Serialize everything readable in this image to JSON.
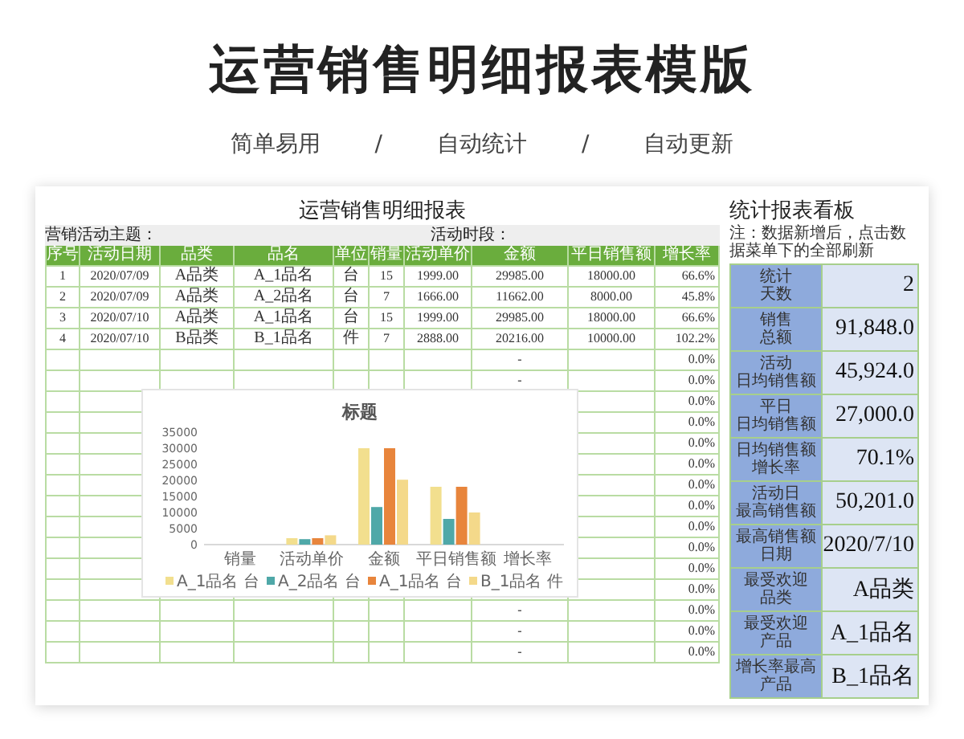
{
  "page": {
    "title": "运营销售明细报表模版",
    "features": [
      "简单易用",
      "自动统计",
      "自动更新"
    ],
    "separator": "/"
  },
  "sheet": {
    "title": "运营销售明细报表",
    "theme_label": "营销活动主题：",
    "period_label": "活动时段：",
    "columns": [
      "序号",
      "活动日期",
      "品类",
      "品名",
      "单位",
      "销量",
      "活动单价",
      "金额",
      "平日销售额",
      "增长率"
    ],
    "rows": [
      {
        "cells": [
          "1",
          "2020/07/09",
          "A品类",
          "A_1品名",
          "台",
          "15",
          "1999.00",
          "29985.00",
          "18000.00",
          "66.6%"
        ]
      },
      {
        "cells": [
          "2",
          "2020/07/09",
          "A品类",
          "A_2品名",
          "台",
          "7",
          "1666.00",
          "11662.00",
          "8000.00",
          "45.8%"
        ]
      },
      {
        "cells": [
          "3",
          "2020/07/10",
          "A品类",
          "A_1品名",
          "台",
          "15",
          "1999.00",
          "29985.00",
          "18000.00",
          "66.6%"
        ]
      },
      {
        "cells": [
          "4",
          "2020/07/10",
          "B品类",
          "B_1品名",
          "件",
          "7",
          "2888.00",
          "20216.00",
          "10000.00",
          "102.2%"
        ]
      },
      {
        "amount": "-",
        "growth": "0.0%"
      },
      {
        "amount": "-",
        "growth": "0.0%"
      },
      {
        "growth": "0.0%"
      },
      {
        "growth": "0.0%"
      },
      {
        "growth": "0.0%"
      },
      {
        "growth": "0.0%"
      },
      {
        "growth": "0.0%"
      },
      {
        "growth": "0.0%"
      },
      {
        "growth": "0.0%"
      },
      {
        "growth": "0.0%"
      },
      {
        "growth": "0.0%"
      },
      {
        "growth": "0.0%"
      },
      {
        "amount": "-",
        "growth": "0.0%"
      },
      {
        "amount": "-",
        "growth": "0.0%"
      },
      {
        "amount": "-",
        "growth": "0.0%"
      }
    ],
    "chart_data": {
      "type": "bar",
      "title": "标题",
      "categories": [
        "销量",
        "活动单价",
        "金额",
        "平日销售额",
        "增长率"
      ],
      "series": [
        {
          "name": "A_1品名 台",
          "color": "#f2df8e",
          "values": [
            0,
            2000,
            30000,
            18000,
            0
          ]
        },
        {
          "name": "A_2品名 台",
          "color": "#4fa8a8",
          "values": [
            0,
            1700,
            11700,
            8000,
            0
          ]
        },
        {
          "name": "A_1品名 台",
          "color": "#e8853c",
          "values": [
            0,
            2000,
            30000,
            18000,
            0
          ]
        },
        {
          "name": "B_1品名 件",
          "color": "#f4d98a",
          "values": [
            0,
            2900,
            20200,
            10000,
            0
          ]
        }
      ],
      "legend": "bottom",
      "ylim": [
        0,
        35000
      ],
      "yticks": [
        0,
        5000,
        10000,
        15000,
        20000,
        25000,
        30000,
        35000
      ]
    }
  },
  "dashboard": {
    "title": "统计报表看板",
    "note": "注：数据新增后，点击数据菜单下的全部刷新",
    "items": [
      {
        "label_lines": [
          "统计",
          "天数"
        ],
        "value": "2"
      },
      {
        "label_lines": [
          "销售",
          "总额"
        ],
        "value": "91,848.0"
      },
      {
        "label_lines": [
          "活动",
          "日均销售额"
        ],
        "value": "45,924.0"
      },
      {
        "label_lines": [
          "平日",
          "日均销售额"
        ],
        "value": "27,000.0"
      },
      {
        "label_lines": [
          "日均销售额",
          "增长率"
        ],
        "value": "70.1%"
      },
      {
        "label_lines": [
          "活动日",
          "最高销售额"
        ],
        "value": "50,201.0"
      },
      {
        "label_lines": [
          "最高销售额",
          "日期"
        ],
        "value": "2020/7/10"
      },
      {
        "label_lines": [
          "最受欢迎",
          "品类"
        ],
        "value": "A品类"
      },
      {
        "label_lines": [
          "最受欢迎",
          "产品"
        ],
        "value": "A_1品名"
      },
      {
        "label_lines": [
          "增长率最高",
          "产品"
        ],
        "value": "B_1品名"
      }
    ]
  }
}
